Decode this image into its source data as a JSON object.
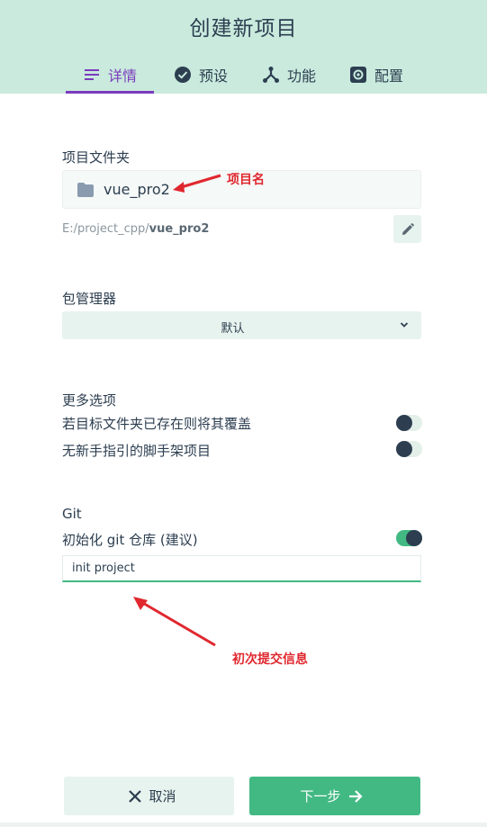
{
  "header": {
    "title": "创建新项目",
    "tabs": [
      {
        "label": "详情",
        "icon": "details-icon",
        "active": true
      },
      {
        "label": "预设",
        "icon": "check-circle-icon",
        "active": false
      },
      {
        "label": "功能",
        "icon": "features-icon",
        "active": false
      },
      {
        "label": "配置",
        "icon": "settings-icon",
        "active": false
      }
    ]
  },
  "project": {
    "folder_label": "项目文件夹",
    "folder_name": "vue_pro2",
    "path_prefix": "E:/project_cpp/",
    "path_name": "vue_pro2"
  },
  "package_manager": {
    "label": "包管理器",
    "selected": "默认"
  },
  "more_options": {
    "label": "更多选项",
    "overwrite_label": "若目标文件夹已存在则将其覆盖",
    "overwrite_enabled": false,
    "no_guide_label": "无新手指引的脚手架项目",
    "no_guide_enabled": false
  },
  "git": {
    "label": "Git",
    "init_label": "初始化 git 仓库 (建议)",
    "init_enabled": true,
    "commit_message": "init project"
  },
  "annotations": {
    "project_name": "项目名",
    "commit_info": "初次提交信息"
  },
  "footer": {
    "cancel_label": "取消",
    "next_label": "下一步"
  },
  "colors": {
    "header_bg": "#c9eadd",
    "accent_purple": "#7b3bbd",
    "accent_green": "#42b983",
    "annotation_red": "#e0272e",
    "text_dark": "#2c3e50"
  }
}
